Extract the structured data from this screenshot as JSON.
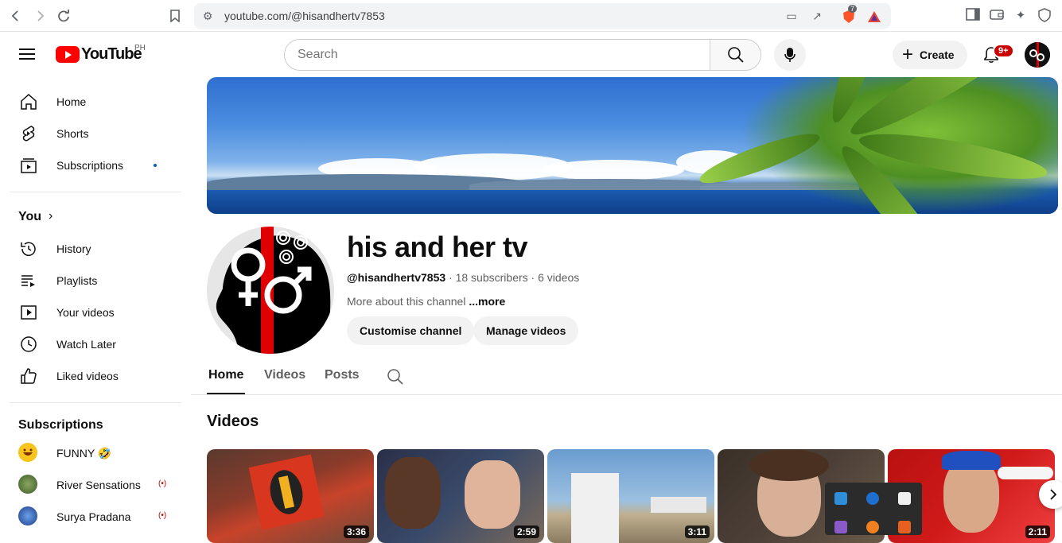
{
  "browser": {
    "url": "youtube.com/@hisandhertv7853",
    "extension_badge": "7"
  },
  "header": {
    "logo_text": "YouTube",
    "region": "PH",
    "search_placeholder": "Search",
    "create_label": "Create",
    "notification_count": "9+"
  },
  "sidebar": {
    "main": [
      {
        "label": "Home",
        "icon": "home-icon"
      },
      {
        "label": "Shorts",
        "icon": "shorts-icon"
      },
      {
        "label": "Subscriptions",
        "icon": "subscriptions-icon"
      }
    ],
    "you_title": "You",
    "you_items": [
      {
        "label": "History",
        "icon": "history-icon"
      },
      {
        "label": "Playlists",
        "icon": "playlists-icon"
      },
      {
        "label": "Your videos",
        "icon": "your-videos-icon"
      },
      {
        "label": "Watch Later",
        "icon": "watch-later-icon"
      },
      {
        "label": "Liked videos",
        "icon": "liked-icon"
      }
    ],
    "subscriptions_title": "Subscriptions",
    "subscriptions": [
      {
        "label": "FUNNY 🤣",
        "live": false
      },
      {
        "label": "River Sensations",
        "live": true
      },
      {
        "label": "Surya Pradana",
        "live": true
      }
    ]
  },
  "channel": {
    "name": "his and her tv",
    "handle": "@hisandhertv7853",
    "stats": " · 18 subscribers · 6 videos",
    "about": "More about this channel ",
    "more": "...more",
    "customise_label": "Customise channel",
    "manage_label": "Manage videos"
  },
  "tabs": [
    "Home",
    "Videos",
    "Posts"
  ],
  "videos_section_title": "Videos",
  "videos": [
    {
      "duration": "3:36",
      "bg": "#8a3b2a"
    },
    {
      "duration": "2:59",
      "bg": "#3a4a6a"
    },
    {
      "duration": "3:11",
      "bg": "#7fa6cc"
    },
    {
      "duration": "",
      "bg": "#4d4038"
    },
    {
      "duration": "2:11",
      "bg": "#d01a1a"
    }
  ],
  "colors": {
    "brand_red": "#ff0000",
    "link_blue": "#065fd4",
    "live_red": "#cc0000"
  }
}
